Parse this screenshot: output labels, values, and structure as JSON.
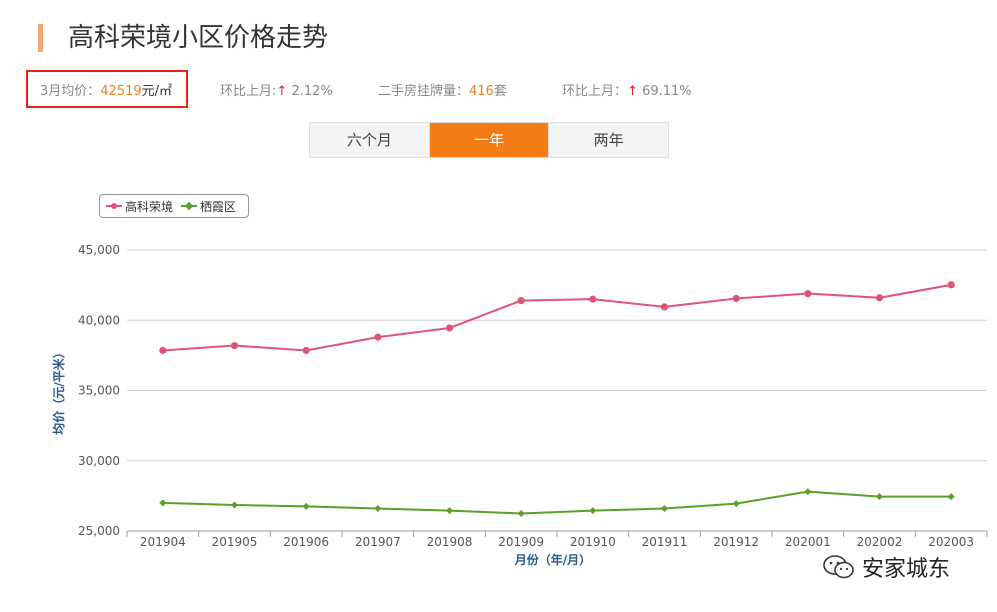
{
  "header": {
    "title": "高科荣境小区价格走势"
  },
  "stats": {
    "avg_price_prefix": "3月均价：",
    "avg_price_value": "42519",
    "avg_price_unit": "元/㎡",
    "mom1_label": "环比上月:",
    "mom1_arrow": "↑",
    "mom1_value": "2.12%",
    "listing_label": "二手房挂牌量：",
    "listing_value": "416",
    "listing_unit": "套",
    "mom2_label": "环比上月：",
    "mom2_arrow": "↑",
    "mom2_value": "69.11%"
  },
  "tabs": [
    {
      "label": "六个月",
      "active": false
    },
    {
      "label": "一年",
      "active": true
    },
    {
      "label": "两年",
      "active": false
    }
  ],
  "colors": {
    "accent": "#f57c14",
    "series1": "#e05577",
    "series2": "#5aa02c",
    "highlight_box": "#e8211c"
  },
  "watermark": {
    "text": "安家城东",
    "icon": "wechat-icon"
  },
  "chart_data": {
    "type": "line",
    "categories": [
      "201904",
      "201905",
      "201906",
      "201907",
      "201908",
      "201909",
      "201910",
      "201911",
      "201912",
      "202001",
      "202002",
      "202003"
    ],
    "series": [
      {
        "name": "高科荣境",
        "color": "#e05577",
        "marker": "circle",
        "values": [
          37850,
          38200,
          37850,
          38800,
          39450,
          41400,
          41500,
          40950,
          41550,
          41900,
          41600,
          42519
        ]
      },
      {
        "name": "栖霞区",
        "color": "#5aa02c",
        "marker": "diamond",
        "values": [
          27000,
          26850,
          26750,
          26600,
          26450,
          26250,
          26450,
          26600,
          26950,
          27800,
          27450,
          27450
        ]
      }
    ],
    "yticks": [
      "25,000",
      "30,000",
      "35,000",
      "40,000",
      "45,000"
    ],
    "ylim": [
      25000,
      45000
    ],
    "ylabel": "均价（元/平米）",
    "xlabel": "月份（年/月）",
    "grid": true,
    "legend": "top-left"
  }
}
